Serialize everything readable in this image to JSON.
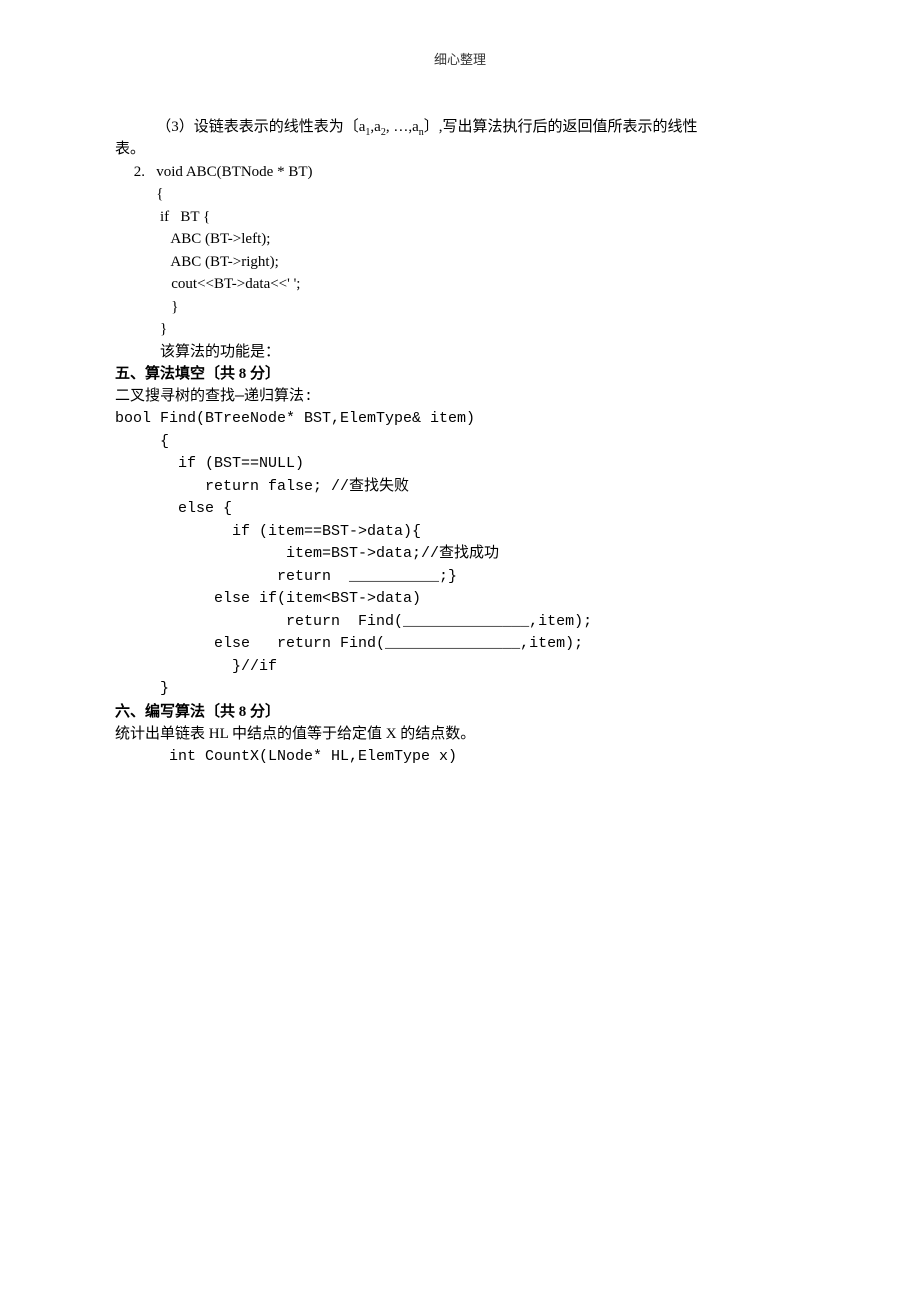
{
  "header": "细心整理",
  "lines": {
    "l1a": "           （3）设链表表示的线性表为〔a",
    "l1b": "1",
    "l1c": ",a",
    "l1d": "2",
    "l1e": ", …,a",
    "l1f": "n",
    "l1g": "〕,写出算法执行后的返回值所表示的线性",
    "l2": "表。",
    "l3": "     2.   void ABC(BTNode * BT)",
    "l4": "           {",
    "l5": "            if   BT {",
    "l6": "               ABC (BT->left);",
    "l7": "               ABC (BT->right);",
    "l8": "               cout<<BT->data<<' ';",
    "l9": "               }",
    "l10": "            }",
    "l11": "            该算法的功能是：",
    "sec5": "五、算法填空〔共 8 分〕",
    "l12": "二叉搜寻树的查找—递归算法:",
    "l13": "bool Find(BTreeNode* BST,ElemType& item)",
    "l14": "     {",
    "l15": "       if (BST==NULL)",
    "l16": "          return false; //查找失败",
    "l17": "       else {",
    "l18": "             if (item==BST->data){",
    "l19": "                   item=BST->data;//查找成功",
    "l20": "                  return  __________;}",
    "l21": "           else if(item<BST->data)",
    "l22": "                   return  Find(______________,item);",
    "l23": "           else   return Find(_______________,item);",
    "l24": "             }//if",
    "l25": "     }",
    "sec6": "六、编写算法〔共 8 分〕",
    "l26": "统计出单链表 HL 中结点的值等于给定值 X 的结点数。",
    "l27": "      int CountX(LNode* HL,ElemType x)"
  }
}
